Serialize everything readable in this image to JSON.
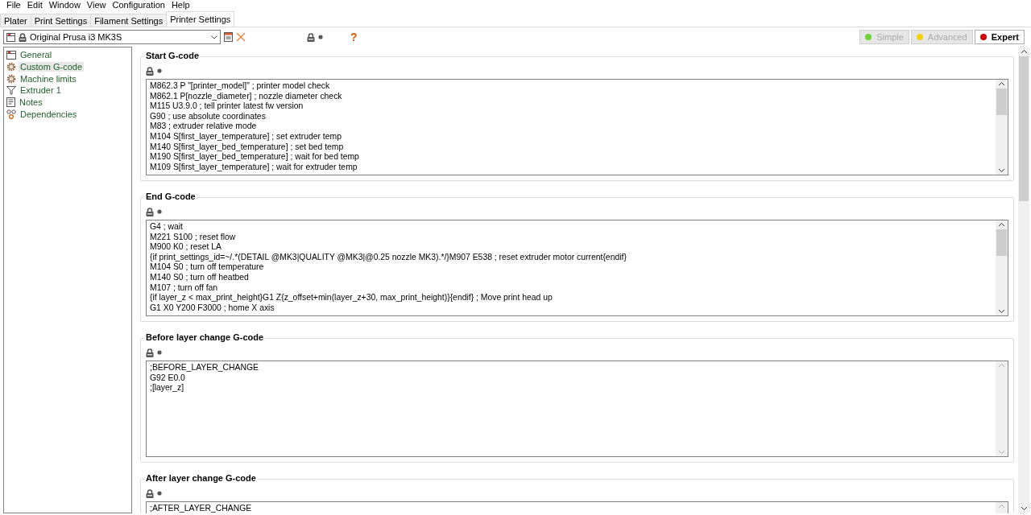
{
  "menu": [
    "File",
    "Edit",
    "Window",
    "View",
    "Configuration",
    "Help"
  ],
  "tabs": [
    {
      "label": "Plater",
      "selected": false
    },
    {
      "label": "Print Settings",
      "selected": false
    },
    {
      "label": "Filament Settings",
      "selected": false
    },
    {
      "label": "Printer Settings",
      "selected": true
    }
  ],
  "toolbar": {
    "preset": "Original Prusa i3 MK3S",
    "help": "?",
    "modes": [
      {
        "label": "Simple",
        "color": "#6fd43a",
        "selected": false
      },
      {
        "label": "Advanced",
        "color": "#f2d20c",
        "selected": false
      },
      {
        "label": "Expert",
        "color": "#d40000",
        "selected": true
      }
    ]
  },
  "sidebar": {
    "items": [
      {
        "label": "General",
        "kind": "general",
        "selected": false
      },
      {
        "label": "Custom G-code",
        "kind": "gear",
        "selected": true
      },
      {
        "label": "Machine limits",
        "kind": "gear",
        "selected": false
      },
      {
        "label": "Extruder 1",
        "kind": "extruder",
        "selected": false
      },
      {
        "label": "Notes",
        "kind": "notes",
        "selected": false
      },
      {
        "label": "Dependencies",
        "kind": "dependencies",
        "selected": false
      }
    ]
  },
  "sections": [
    {
      "title": "Start G-code",
      "lines": [
        "M862.3 P \"[printer_model]\" ; printer model check",
        "M862.1 P[nozzle_diameter] ; nozzle diameter check",
        "M115 U3.9.0 ; tell printer latest fw version",
        "G90 ; use absolute coordinates",
        "M83 ; extruder relative mode",
        "M104 S[first_layer_temperature] ; set extruder temp",
        "M140 S[first_layer_bed_temperature] ; set bed temp",
        "M190 S[first_layer_bed_temperature] ; wait for bed temp",
        "M109 S[first_layer_temperature] ; wait for extruder temp"
      ]
    },
    {
      "title": "End G-code",
      "lines": [
        "G4 ; wait",
        "M221 S100 ; reset flow",
        "M900 K0 ; reset LA",
        "{if print_settings_id=~/.*(DETAIL @MK3|QUALITY @MK3|@0.25 nozzle MK3).*/}M907 E538 ; reset extruder motor current{endif}",
        "M104 S0 ; turn off temperature",
        "M140 S0 ; turn off heatbed",
        "M107 ; turn off fan",
        "{if layer_z < max_print_height}G1 Z{z_offset+min(layer_z+30, max_print_height)}{endif} ; Move print head up",
        "G1 X0 Y200 F3000 ; home X axis"
      ]
    },
    {
      "title": "Before layer change G-code",
      "lines": [
        ";BEFORE_LAYER_CHANGE",
        "G92 E0.0",
        ";[layer_z]"
      ]
    },
    {
      "title": "After layer change G-code",
      "lines": [
        ";AFTER_LAYER_CHANGE"
      ]
    }
  ]
}
